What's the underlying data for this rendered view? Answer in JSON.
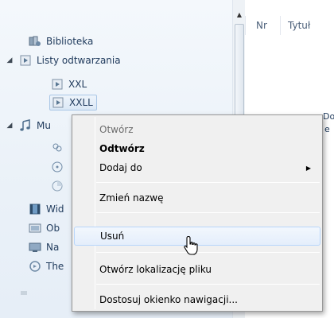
{
  "nav": {
    "items": [
      {
        "label": "Biblioteka",
        "icon": "library-icon"
      },
      {
        "label": "Listy odtwarzania",
        "icon": "playlist-icon",
        "expanded": true
      },
      {
        "label": "XXL",
        "icon": "playlist-icon"
      },
      {
        "label": "XXLL",
        "icon": "playlist-icon",
        "selected": true
      },
      {
        "label": "Mu",
        "icon": "music-note-icon",
        "expanded": true
      },
      {
        "label": "Wid",
        "icon": "video-icon"
      },
      {
        "label": "Ob",
        "icon": "picture-icon"
      },
      {
        "label": "Na",
        "icon": "recorded-tv-icon"
      },
      {
        "label": "The",
        "icon": "disc-icon"
      }
    ]
  },
  "columns": [
    {
      "label": "Nr"
    },
    {
      "label": "Tytuł"
    }
  ],
  "truncated_text": [
    "Do",
    "e"
  ],
  "context_menu": {
    "items": [
      {
        "label": "Otwórz",
        "state": "disabled"
      },
      {
        "label": "Odtwórz",
        "state": "default"
      },
      {
        "label": "Dodaj do",
        "state": "submenu"
      },
      {
        "label": "Zmień nazwę",
        "state": "normal"
      },
      {
        "label": "Usuń",
        "state": "hover"
      },
      {
        "label": "Otwórz lokalizację pliku",
        "state": "normal"
      },
      {
        "label": "Dostosuj okienko nawigacji...",
        "state": "normal"
      }
    ]
  }
}
